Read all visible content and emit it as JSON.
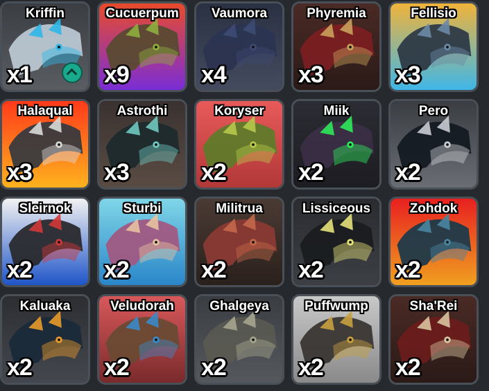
{
  "creatures": [
    {
      "name": "Kriffin",
      "count": "x1",
      "icon": "kriffin-creature-icon",
      "bg": [
        "#3a3d42",
        "#5a5e63"
      ],
      "body": "#b9c7d2",
      "accent": "#2fb7e8",
      "badge": true
    },
    {
      "name": "Cucuerpum",
      "count": "x9",
      "icon": "cucuerpum-creature-icon",
      "bg": [
        "#e84b2b",
        "#7a2dd6"
      ],
      "body": "#5a4a32",
      "accent": "#8fae3e"
    },
    {
      "name": "Vaumora",
      "count": "x4",
      "icon": "vaumora-creature-icon",
      "bg": [
        "#2a3142",
        "#444b5e"
      ],
      "body": "#2b3450",
      "accent": "#3d4a72"
    },
    {
      "name": "Phyremia",
      "count": "x3",
      "icon": "phyremia-creature-icon",
      "bg": [
        "#4a2a24",
        "#2a1a18"
      ],
      "body": "#7a1f22",
      "accent": "#c9a05a"
    },
    {
      "name": "Fellisio",
      "count": "x3",
      "icon": "fellisio-creature-icon",
      "bg": [
        "#f0b43a",
        "#3fb6e8"
      ],
      "body": "#2e3a46",
      "accent": "#6b8aa6"
    },
    {
      "name": "Halaqual",
      "count": "x3",
      "icon": "halaqual-creature-icon",
      "bg": [
        "#ff3a1a",
        "#ffb21e"
      ],
      "body": "#3a3a3e",
      "accent": "#d9d9d9"
    },
    {
      "name": "Astrothi",
      "count": "x3",
      "icon": "astrothi-creature-icon",
      "bg": [
        "#3a3230",
        "#5a4c44"
      ],
      "body": "#1e2a2c",
      "accent": "#6fc8c0"
    },
    {
      "name": "Koryser",
      "count": "x2",
      "icon": "koryser-creature-icon",
      "bg": [
        "#e85a5a",
        "#b23838"
      ],
      "body": "#5f7a2a",
      "accent": "#b6c84a"
    },
    {
      "name": "Miik",
      "count": "x2",
      "icon": "miik-creature-icon",
      "bg": [
        "#2c2c34",
        "#1c1c22"
      ],
      "body": "#3a2e44",
      "accent": "#2fe85a"
    },
    {
      "name": "Pero",
      "count": "x2",
      "icon": "pero-creature-icon",
      "bg": [
        "#3a3d42",
        "#6a6e74"
      ],
      "body": "#141a22",
      "accent": "#c9ccd1"
    },
    {
      "name": "Sleirnok",
      "count": "x2",
      "icon": "sleirnok-creature-icon",
      "bg": [
        "#f2f2f2",
        "#1f55c8"
      ],
      "body": "#2a2a2e",
      "accent": "#d23838"
    },
    {
      "name": "Sturbi",
      "count": "x2",
      "icon": "sturbi-creature-icon",
      "bg": [
        "#7fd6e8",
        "#2a86c8"
      ],
      "body": "#a05a82",
      "accent": "#e8c2a0"
    },
    {
      "name": "Militrua",
      "count": "x2",
      "icon": "militrua-creature-icon",
      "bg": [
        "#4a3a34",
        "#2a201c"
      ],
      "body": "#8a3a34",
      "accent": "#c4684a"
    },
    {
      "name": "Lissiceous",
      "count": "x2",
      "icon": "lissiceous-creature-icon",
      "bg": [
        "#2a2c30",
        "#3c3f44"
      ],
      "body": "#1a1c20",
      "accent": "#e6e27a"
    },
    {
      "name": "Zohdok",
      "count": "x2",
      "icon": "zohdok-creature-icon",
      "bg": [
        "#e82020",
        "#f0a020"
      ],
      "body": "#1f3a4a",
      "accent": "#4a86a0"
    },
    {
      "name": "Kaluaka",
      "count": "x2",
      "icon": "kaluaka-creature-icon",
      "bg": [
        "#2c2e32",
        "#44484e"
      ],
      "body": "#1a2a3a",
      "accent": "#e89a2a"
    },
    {
      "name": "Veludorah",
      "count": "x2",
      "icon": "veludorah-creature-icon",
      "bg": [
        "#d8585a",
        "#7a2a2c"
      ],
      "body": "#6a4a34",
      "accent": "#3a8ac8"
    },
    {
      "name": "Ghalgeya",
      "count": "x2",
      "icon": "ghalgeya-creature-icon",
      "bg": [
        "#3a3d42",
        "#55595e"
      ],
      "body": "#5a5a52",
      "accent": "#a6a68e"
    },
    {
      "name": "Puffwump",
      "count": "x2",
      "icon": "puffwump-creature-icon",
      "bg": [
        "#c8c8c8",
        "#8a8a8a"
      ],
      "body": "#3a3634",
      "accent": "#c8a040"
    },
    {
      "name": "Sha'Rei",
      "count": "x2",
      "icon": "sharei-creature-icon",
      "bg": [
        "#4a2a24",
        "#2a1a18"
      ],
      "body": "#6a1c1c",
      "accent": "#d8c4a0"
    }
  ]
}
